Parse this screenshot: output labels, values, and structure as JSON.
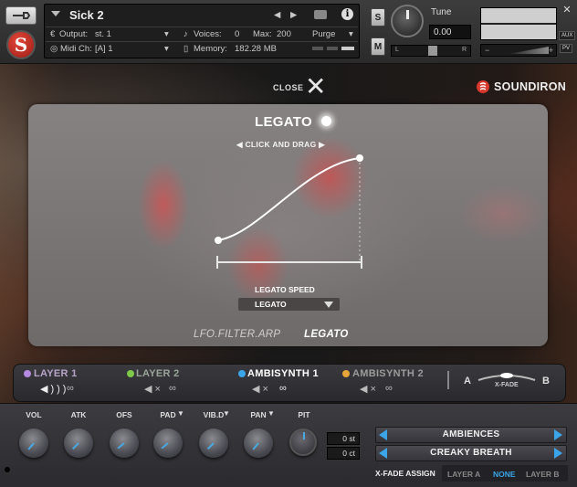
{
  "header": {
    "instrument_name": "Sick 2",
    "output_label": "Output:",
    "output_value": "st. 1",
    "midi_label": "Midi Ch:",
    "midi_value": "[A]  1",
    "voices_label": "Voices:",
    "voices_value": "0",
    "max_label": "Max:",
    "max_value": "200",
    "purge_label": "Purge",
    "memory_label": "Memory:",
    "memory_value": "182.28 MB",
    "solo_label": "S",
    "mute_label": "M",
    "tune_label": "Tune",
    "tune_value": "0.00",
    "pan_left": "L",
    "pan_right": "R",
    "aux_label": "AUX",
    "pv_label": "PV"
  },
  "brand": "SOUNDIRON",
  "close_label": "CLOSE",
  "legato_panel": {
    "title": "LEGATO",
    "hint": "◀  CLICK AND DRAG  ▶",
    "speed_label": "LEGATO SPEED",
    "speed_value": "LEGATO",
    "tabs": [
      "LFO.FILTER.ARP",
      "LEGATO"
    ],
    "active_tab": "LEGATO",
    "curve_start": 0.0,
    "curve_end": 1.0
  },
  "layers": [
    {
      "name": "LAYER 1",
      "color": "#b48be0",
      "active": false
    },
    {
      "name": "LAYER 2",
      "color": "#7ec84a",
      "active": false
    },
    {
      "name": "AMBISYNTH 1",
      "color": "#3aa5e8",
      "active": true
    },
    {
      "name": "AMBISYNTH 2",
      "color": "#e8a53a",
      "active": false
    }
  ],
  "xfade": {
    "a": "A",
    "b": "B",
    "label": "X-FADE"
  },
  "knobs": [
    {
      "label": "VOL",
      "has_menu": false
    },
    {
      "label": "ATK",
      "has_menu": false
    },
    {
      "label": "OFS",
      "has_menu": false
    },
    {
      "label": "PAD",
      "has_menu": true
    },
    {
      "label": "VIB.D",
      "has_menu": true
    },
    {
      "label": "PAN",
      "has_menu": true
    },
    {
      "label": "PIT",
      "has_menu": false
    }
  ],
  "pitch": {
    "semitones": "0 st",
    "cents": "0 ct"
  },
  "presets": {
    "category": "AMBIENCES",
    "preset": "CREAKY BREATH"
  },
  "xfade_assign": {
    "label": "X-FADE ASSIGN",
    "options": [
      "LAYER A",
      "NONE",
      "LAYER B"
    ],
    "selected": "NONE"
  }
}
